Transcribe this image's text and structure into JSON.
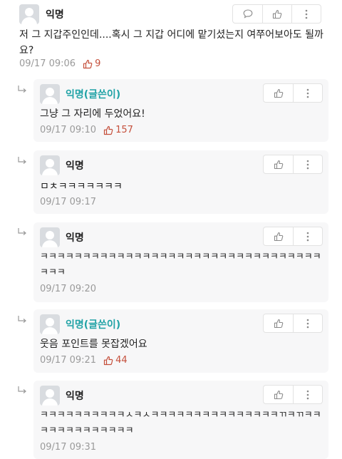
{
  "main": {
    "name": "익명",
    "text": "저 그 지갑주인인데....혹시 그 지갑 어디에 맡기셨는지 여쭈어보아도 될까요?",
    "time": "09/17 09:06",
    "likes": "9"
  },
  "replies": [
    {
      "name": "익명(글쓴이)",
      "text": "그냥 그 자리에 두었어요!",
      "time": "09/17 09:10",
      "likes": "157"
    },
    {
      "name": "익명",
      "text": "ㅁㅊㅋㅋㅋㅋㅋㅋㅋ",
      "time": "09/17 09:17"
    },
    {
      "name": "익명",
      "text": "ㅋㅋㅋㅋㅋㅋㅋㅋㅋㅋㅋㅋㅋㅋㅋㅋㅋㅋㅋㅋㅋㅋㅋㅋㅋㅋㅋㅋㅋㅋㅋㅋㅋㅋㅋㅋ",
      "time": "09/17 09:20"
    },
    {
      "name": "익명(글쓴이)",
      "text": "웃음 포인트를 못잡겠어요",
      "time": "09/17 09:21",
      "likes": "44"
    },
    {
      "name": "익명",
      "text": "ㅋㅋㅋㅋㅋㅋㅋㅋㅋㅋㅅㅋㅅㅋㅋㅋㅋㅋㅋㅋㅋㅋㅋㅋㅋㅋㅋㅋㄲㅋㄲㅋㅋㅋㅋㅋㅋㅋㅋㅋㅋㅋㅋㅋ",
      "time": "09/17 09:31"
    }
  ],
  "icons": {
    "comment": "speech-bubble-icon",
    "like": "thumbs-up-icon",
    "more": "vertical-dots-icon",
    "reply": "reply-arrow-icon"
  },
  "colors": {
    "author_name": "#21a3a6",
    "like_count": "#c5503c",
    "reply_bg": "#f7f7f8",
    "meta": "#9a9a9a"
  }
}
